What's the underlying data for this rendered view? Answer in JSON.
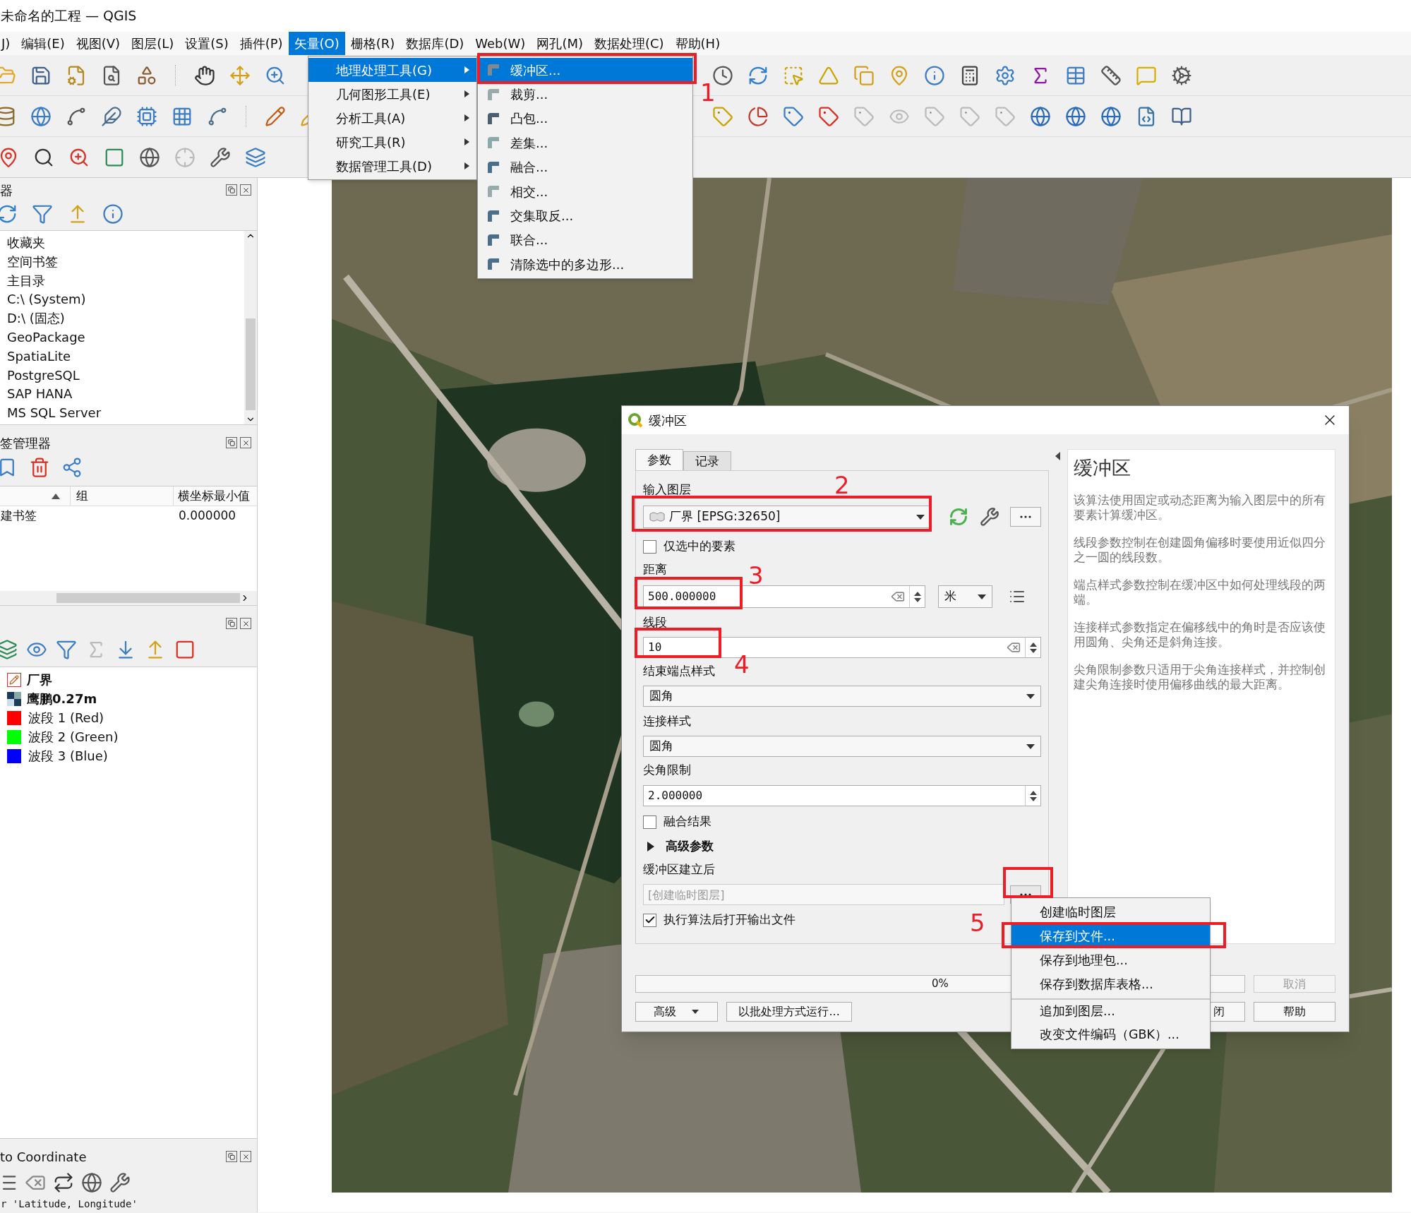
{
  "window": {
    "title": "未命名的工程 — QGIS"
  },
  "menu_bar": [
    {
      "label": "J)",
      "selected": false
    },
    {
      "label": "编辑(E)",
      "selected": false
    },
    {
      "label": "视图(V)",
      "selected": false
    },
    {
      "label": "图层(L)",
      "selected": false
    },
    {
      "label": "设置(S)",
      "selected": false
    },
    {
      "label": "插件(P)",
      "selected": false
    },
    {
      "label": "矢量(O)",
      "selected": true
    },
    {
      "label": "栅格(R)",
      "selected": false
    },
    {
      "label": "数据库(D)",
      "selected": false
    },
    {
      "label": "Web(W)",
      "selected": false
    },
    {
      "label": "网孔(M)",
      "selected": false
    },
    {
      "label": "数据处理(C)",
      "selected": false
    },
    {
      "label": "帮助(H)",
      "selected": false
    }
  ],
  "vector_menu": [
    {
      "label": "地理处理工具(G)",
      "selected": true
    },
    {
      "label": "几何图形工具(E)",
      "selected": false
    },
    {
      "label": "分析工具(A)",
      "selected": false
    },
    {
      "label": "研究工具(R)",
      "selected": false
    },
    {
      "label": "数据管理工具(D)",
      "selected": false
    }
  ],
  "geoprocessing_submenu": [
    {
      "label": "缓冲区...",
      "selected": true
    },
    {
      "label": "裁剪...",
      "selected": false
    },
    {
      "label": "凸包...",
      "selected": false
    },
    {
      "label": "差集...",
      "selected": false
    },
    {
      "label": "融合...",
      "selected": false
    },
    {
      "label": "相交...",
      "selected": false
    },
    {
      "label": "交集取反...",
      "selected": false
    },
    {
      "label": "联合...",
      "selected": false
    },
    {
      "label": "清除选中的多边形...",
      "selected": false
    }
  ],
  "browser_panel": {
    "title": "器",
    "items": [
      "收藏夹",
      "空间书签",
      "主目录",
      "C:\\ (System)",
      "D:\\ (固态)",
      "GeoPackage",
      "SpatiaLite",
      "PostgreSQL",
      "SAP HANA",
      "MS SQL Server"
    ]
  },
  "bookmark_panel": {
    "title": "签管理器",
    "columns": [
      "组",
      "横坐标最小值"
    ],
    "rows": [
      {
        "name": "建书签",
        "x_min": "0.000000"
      }
    ]
  },
  "layers_panel": {
    "layers": [
      {
        "name": "厂界",
        "kind": "vector"
      },
      {
        "name": "鹰鹏0.27m",
        "kind": "raster",
        "children": [
          {
            "name": "波段 1 (Red)",
            "color": "#ff0000"
          },
          {
            "name": "波段 2 (Green)",
            "color": "#00ff00"
          },
          {
            "name": "波段 3 (Blue)",
            "color": "#0000ff"
          }
        ]
      }
    ]
  },
  "coordinate_panel": {
    "title": "to Coordinate",
    "hint": "r 'Latitude, Longitude'"
  },
  "dialog": {
    "title": "缓冲区",
    "tabs": [
      {
        "label": "参数",
        "selected": true
      },
      {
        "label": "记录",
        "selected": false
      }
    ],
    "input_layer": {
      "label": "输入图层",
      "value": "厂界 [EPSG:32650]"
    },
    "selected_only": {
      "label": "仅选中的要素",
      "checked": false
    },
    "distance": {
      "label": "距离",
      "value": "500.000000",
      "unit": "米"
    },
    "segments": {
      "label": "线段",
      "value": "10"
    },
    "end_cap": {
      "label": "结束端点样式",
      "value": "圆角"
    },
    "join_style": {
      "label": "连接样式",
      "value": "圆角"
    },
    "miter_limit": {
      "label": "尖角限制",
      "value": "2.000000"
    },
    "dissolve": {
      "label": "融合结果",
      "checked": false
    },
    "advanced": {
      "label": "高级参数",
      "expanded": false
    },
    "output": {
      "label": "缓冲区建立后",
      "placeholder": "[创建临时图层]"
    },
    "open_output": {
      "label": "执行算法后打开输出文件",
      "checked": true
    },
    "progress": {
      "level": 0,
      "reading": "0%"
    },
    "buttons": {
      "advanced": "高级",
      "batch": "以批处理方式运行...",
      "close": "闭",
      "cancel": "取消",
      "cancel_disabled": true,
      "help": "帮助"
    },
    "help": {
      "title": "缓冲区",
      "paragraphs": [
        "该算法使用固定或动态距离为输入图层中的所有要素计算缓冲区。",
        "线段参数控制在创建圆角偏移时要使用近似四分之一圆的线段数。",
        "端点样式参数控制在缓冲区中如何处理线段的两端。",
        "连接样式参数指定在偏移线中的角时是否应该使用圆角、尖角还是斜角连接。",
        "尖角限制参数只适用于尖角连接样式，并控制创建尖角连接时使用偏移曲线的最大距离。"
      ]
    }
  },
  "output_menu": [
    {
      "label": "创建临时图层",
      "selected": false,
      "separator_above": false
    },
    {
      "label": "保存到文件...",
      "selected": true,
      "separator_above": false
    },
    {
      "label": "保存到地理包...",
      "selected": false,
      "separator_above": false
    },
    {
      "label": "保存到数据库表格...",
      "selected": false,
      "separator_above": false
    },
    {
      "label": "追加到图层...",
      "selected": false,
      "separator_above": true
    },
    {
      "label": "改变文件编码（GBK）...",
      "selected": false,
      "separator_above": false
    }
  ],
  "annotations": [
    {
      "label": "1"
    },
    {
      "label": "2"
    },
    {
      "label": "3"
    },
    {
      "label": "4"
    },
    {
      "label": "5"
    }
  ]
}
